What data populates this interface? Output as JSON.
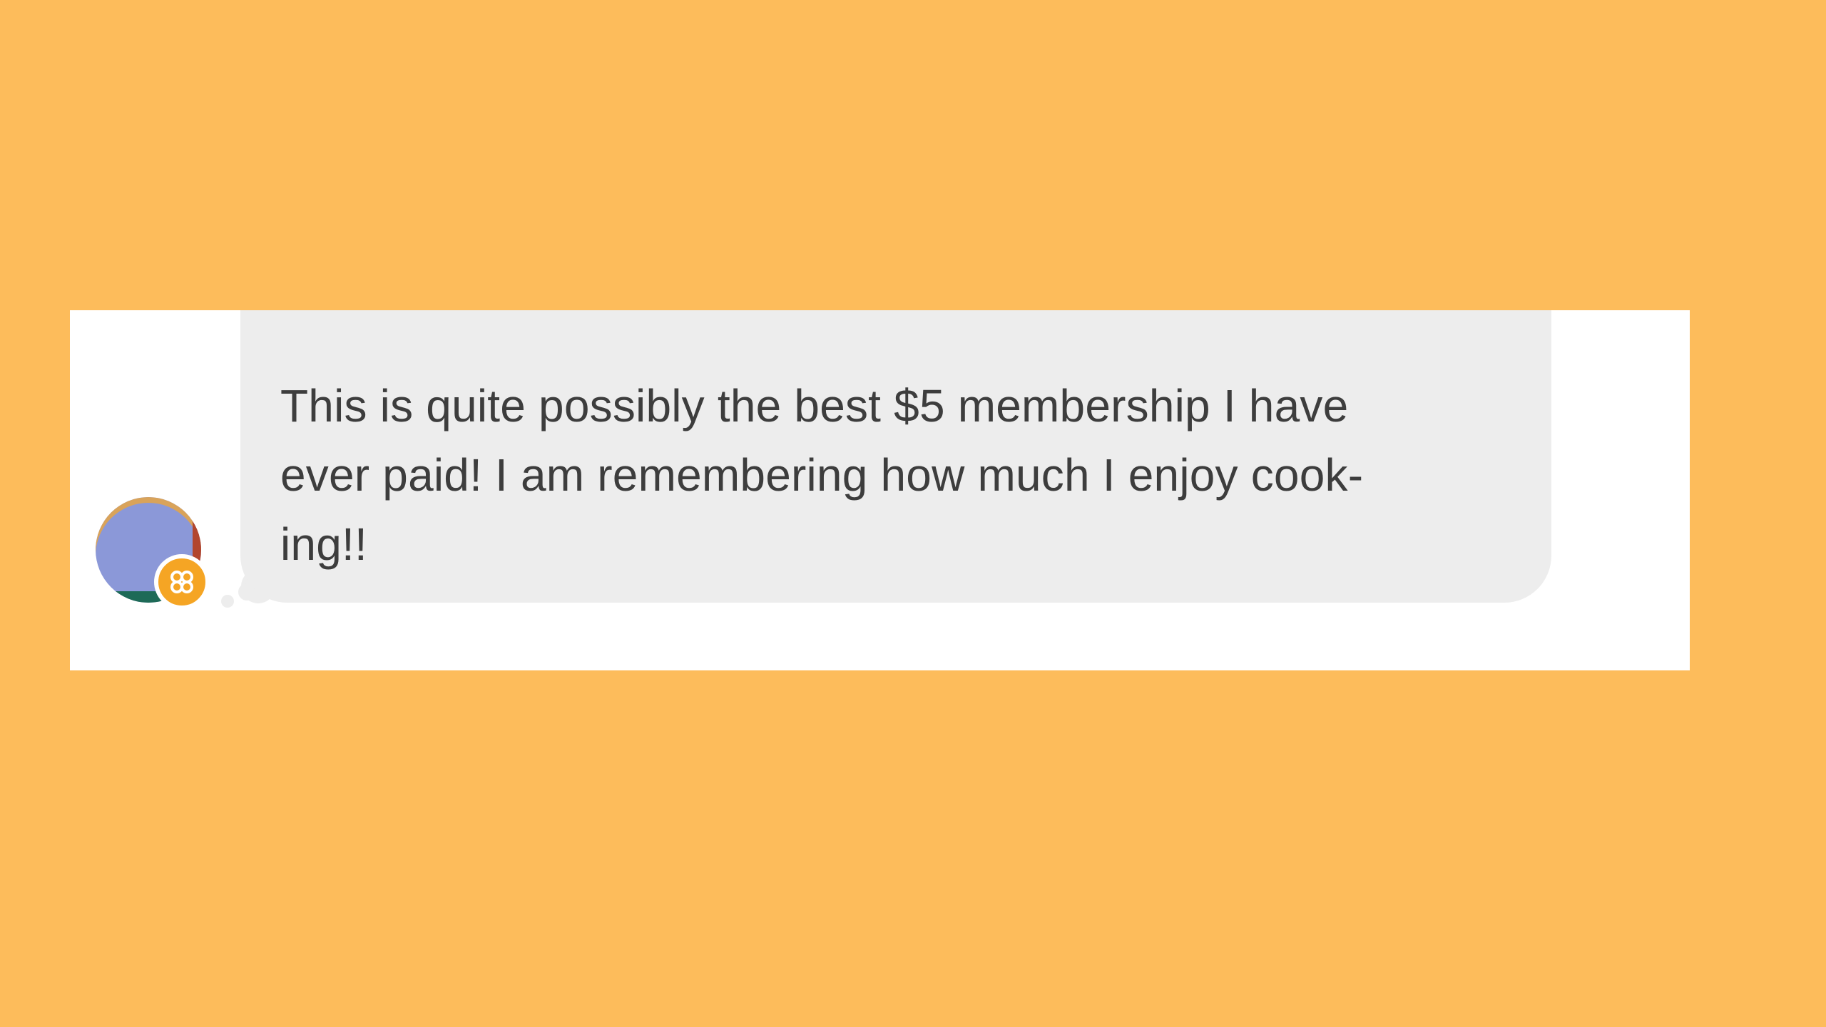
{
  "message": {
    "text": "This is quite possibly the best $5 membership I have\never paid! I am remembering how much I enjoy cook-\ning!!"
  },
  "avatar": {
    "badge_icon": "flower-icon"
  },
  "colors": {
    "background": "#FDBC5B",
    "card": "#FFFFFF",
    "bubble": "#EDEDED",
    "text": "#3D3D3D",
    "badge": "#F5A524",
    "avatar_main": "#8B98D8"
  }
}
